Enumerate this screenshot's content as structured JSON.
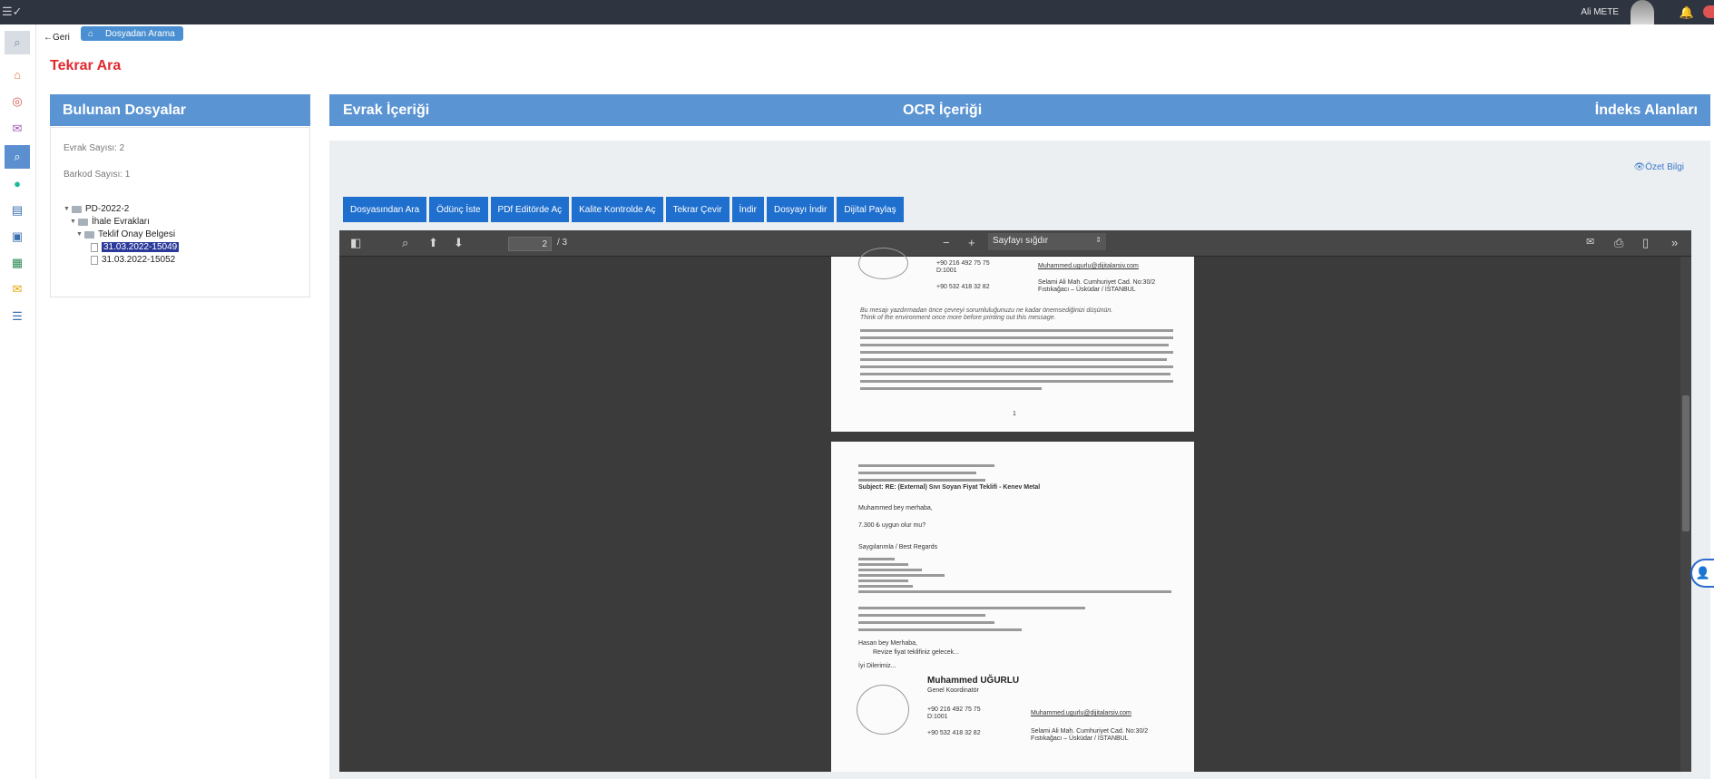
{
  "topbar": {
    "user_name": "Ali METE"
  },
  "nav": {
    "back_label": "Geri",
    "breadcrumb": "Dosyadan Arama"
  },
  "page": {
    "title": "Tekrar Ara"
  },
  "left_panel": {
    "title": "Bulunan Dosyalar",
    "evrak_count": "Evrak Sayısı: 2",
    "barkod_count": "Barkod Sayısı: 1",
    "tree": {
      "root": "PD-2022-2",
      "folder1": "İhale Evrakları",
      "folder2": "Teklif Onay Belgesi",
      "file1": "31.03.2022-15049",
      "file2": "31.03.2022-15052"
    }
  },
  "right_panel": {
    "tab_evrak": "Evrak İçeriği",
    "tab_ocr": "OCR İçeriği",
    "tab_indeks": "İndeks Alanları",
    "summary_link": "Özet Bilgi",
    "buttons": [
      "Dosyasından Ara",
      "Ödünç İste",
      "PDf Editörde Aç",
      "Kalite Kontrolde Aç",
      "Tekrar Çevir",
      "İndir",
      "Dosyayı İndir",
      "Dijital Paylaş"
    ]
  },
  "viewer": {
    "current_page": "2",
    "total_pages": "/ 3",
    "zoom_label": "Sayfayı sığdır"
  },
  "document": {
    "page2_subject_1": "Subject: RE: (External) Sıvı Soyan Fiyat Teklifi - Kenev Metal",
    "page2_greeting": "Muhammed bey merhaba,",
    "page2_amount": "7.300 ₺ uygun olur mu?",
    "page2_regards": "Saygılarımla / Best Regards",
    "page2_reply_greeting": "Hasan bey Merhaba,",
    "page2_reply_body": "Revize fiyat teklifiniz gelecek...",
    "page2_closing": "İyi Dilerimiz...",
    "signature_name": "Muhammed UĞURLU",
    "signature_title": "Genel Koordinatör",
    "phone_1": "+90 216 492 75 75",
    "phone_ext": "D:1001",
    "email": "Muhammed.ugurlu@dijitalarsiv.com",
    "mobile": "+90 532 418 32 82",
    "address_1": "Selami Ali Mah. Cumhuriyet Cad. No:30/2",
    "address_2": "Fıstıkağacı – Üsküdar / İSTANBUL",
    "page1_warning_1": "Bu mesajı yazdırmadan önce çevreyi sorumluluğunuzu ne kadar önemsediğinizi düşünün.",
    "page1_warning_2": "Think of the environment once more before printing out this message.",
    "page1_footer": "1"
  }
}
